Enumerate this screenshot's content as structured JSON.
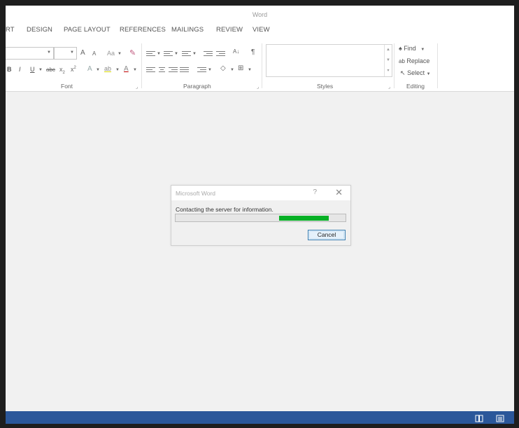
{
  "window": {
    "title": "Word"
  },
  "tabs": [
    "RT",
    "DESIGN",
    "PAGE LAYOUT",
    "REFERENCES",
    "MAILINGS",
    "REVIEW",
    "VIEW"
  ],
  "ribbon": {
    "font": {
      "label": "Font",
      "grow": "A",
      "shrink": "A",
      "change_case": "Aa",
      "bold": "B",
      "italic": "I",
      "underline": "U",
      "strikethrough": "abc",
      "subscript": "x",
      "sub_mark": "2",
      "superscript": "x",
      "sup_mark": "2",
      "text_effects": "A",
      "highlight": "ab",
      "font_color": "A"
    },
    "paragraph": {
      "label": "Paragraph",
      "sort": "A↓",
      "pilcrow": "¶"
    },
    "styles": {
      "label": "Styles"
    },
    "editing": {
      "label": "Editing",
      "find": "Find",
      "replace": "Replace",
      "select": "Select"
    }
  },
  "dialog": {
    "title": "Microsoft Word",
    "help": "?",
    "close": "✕",
    "message": "Contacting the server for information.",
    "progress": {
      "start": 0.61,
      "end": 0.9,
      "color": "#06b025"
    },
    "cancel_label": "Cancel"
  },
  "statusbar": {
    "color": "#2b579a",
    "icons": [
      "read-mode-icon",
      "print-layout-icon"
    ]
  },
  "colors": {
    "ribbon_bg": "#ffffff",
    "workspace_bg": "#f1f1f1",
    "accent": "#2b579a"
  }
}
